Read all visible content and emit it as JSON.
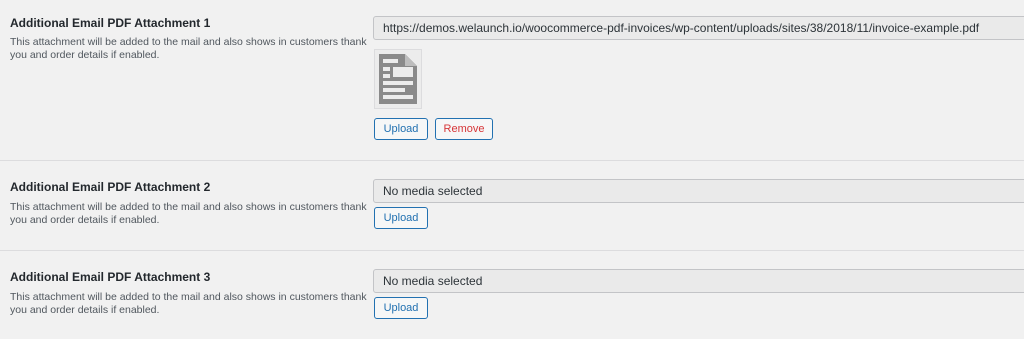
{
  "attachments": [
    {
      "title": "Additional Email PDF Attachment 1",
      "description": "This attachment will be added to the mail and also shows in customers thank you and order details if enabled.",
      "value": "https://demos.welaunch.io/woocommerce-pdf-invoices/wp-content/uploads/sites/38/2018/11/invoice-example.pdf",
      "thumbnail_icon": "document-icon",
      "upload_label": "Upload",
      "remove_label": "Remove"
    },
    {
      "title": "Additional Email PDF Attachment 2",
      "description": "This attachment will be added to the mail and also shows in customers thank you and order details if enabled.",
      "placeholder": "No media selected",
      "upload_label": "Upload"
    },
    {
      "title": "Additional Email PDF Attachment 3",
      "description": "This attachment will be added to the mail and also shows in customers thank you and order details if enabled.",
      "placeholder": "No media selected",
      "upload_label": "Upload"
    }
  ],
  "colors": {
    "background": "#f1f1f1",
    "input_background": "#eaeaea",
    "button_border": "#2271b1",
    "remove_text": "#d63638"
  }
}
